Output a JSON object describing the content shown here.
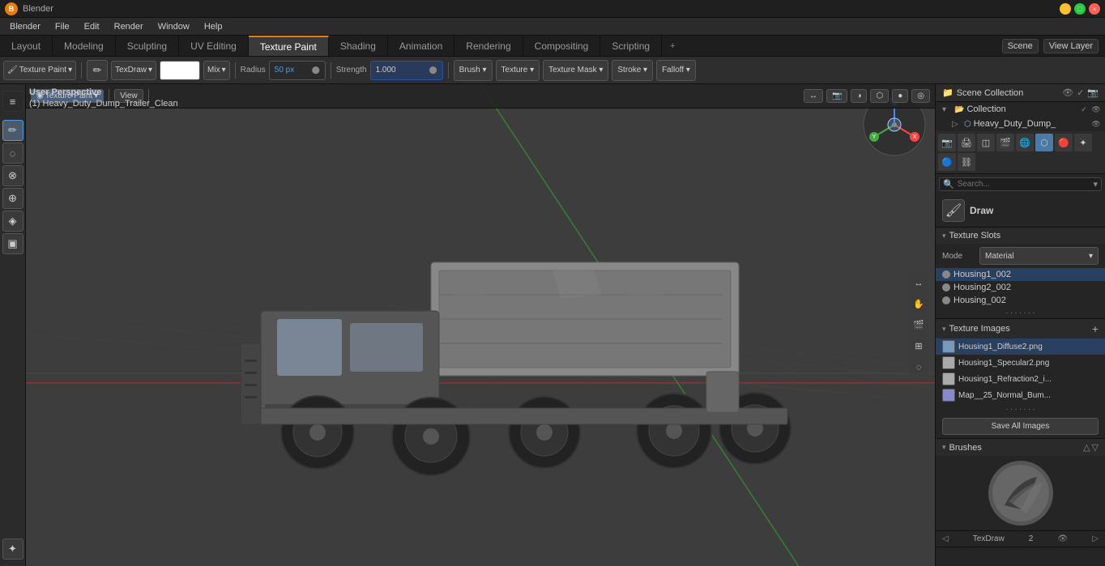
{
  "titlebar": {
    "title": "Blender",
    "logo": "B"
  },
  "menubar": {
    "items": [
      "Blender",
      "File",
      "Edit",
      "Render",
      "Window",
      "Help"
    ]
  },
  "workspacetabs": {
    "tabs": [
      "Layout",
      "Modeling",
      "Sculpting",
      "UV Editing",
      "Texture Paint",
      "Shading",
      "Animation",
      "Rendering",
      "Compositing",
      "Scripting"
    ],
    "active": "Texture Paint",
    "plus_label": "+",
    "scene_label": "Scene",
    "view_layer_label": "View Layer"
  },
  "toolbar_top": {
    "mode_label": "Texture Paint",
    "brush_label": "TexDraw",
    "blend_label": "Mix",
    "radius_label": "Radius",
    "radius_value": "50 px",
    "strength_label": "Strength",
    "strength_value": "1.000",
    "brush_btn": "Brush ▾",
    "texture_btn": "Texture ▾",
    "texture_mask_btn": "Texture Mask ▾",
    "stroke_btn": "Stroke ▾",
    "falloff_btn": "Falloff ▾"
  },
  "header_bar": {
    "panel_label": "Texture Paint",
    "view_btn": "View",
    "mode_icon": "◉"
  },
  "viewport": {
    "perspective": "User Perspective",
    "object": "(1) Heavy_Duty_Dump_Trailer_Clean"
  },
  "left_toolbar": {
    "tools": [
      {
        "name": "select",
        "icon": "◱",
        "active": false
      },
      {
        "name": "cursor",
        "icon": "✛",
        "active": false
      },
      {
        "name": "paint-brush",
        "icon": "✏",
        "active": true
      },
      {
        "name": "clone",
        "icon": "⊕",
        "active": false
      },
      {
        "name": "fill",
        "icon": "◈",
        "active": false
      },
      {
        "name": "smear",
        "icon": "⊗",
        "active": false
      },
      {
        "name": "mask",
        "icon": "▣",
        "active": false
      },
      {
        "name": "eyedropper",
        "icon": "✦",
        "active": false
      }
    ]
  },
  "right_panel": {
    "scene_collection_label": "Scene Collection",
    "collection_label": "Collection",
    "object_label": "Heavy_Duty_Dump_",
    "collection_icons": [
      "👁",
      "🖱",
      "📷"
    ],
    "props_toolbar_icons": [
      "≡",
      "📷",
      "🔧",
      "⬡",
      "🎨",
      "🌑",
      "📐",
      "🔗",
      "🔴",
      "⚙"
    ],
    "active_props_icon": 5,
    "draw_label": "Draw",
    "texture_slots_label": "Texture Slots",
    "texture_slots": [
      {
        "name": "Housing1_002",
        "active": true
      },
      {
        "name": "Housing2_002",
        "active": false
      },
      {
        "name": "Housing_002",
        "active": false
      }
    ],
    "mode_label": "Mode",
    "mode_value": "Material",
    "texture_images_label": "Texture Images",
    "texture_images": [
      {
        "name": "Housing1_Diffuse2.png",
        "color": "#8899aa",
        "active": true
      },
      {
        "name": "Housing1_Specular2.png",
        "color": "#aaaaaa",
        "active": false
      },
      {
        "name": "Housing1_Refraction2_i...",
        "color": "#aaaaaa",
        "active": false
      },
      {
        "name": "Map__25_Normal_Bum...",
        "color": "#8888cc",
        "active": false
      }
    ],
    "save_all_label": "Save All Images",
    "brushes_label": "Brushes",
    "brush_name": "TexDraw",
    "brush_number": "2"
  },
  "viewport_controls": {
    "buttons": [
      "↔",
      "✋",
      "🎬",
      "⊞",
      "◌"
    ]
  },
  "colors": {
    "accent": "#e87d0d",
    "active_blue": "#2a4060",
    "active_tab": "#3a3a3a",
    "bg_dark": "#1e1e1e",
    "bg_mid": "#2b2b2b",
    "bg_panel": "#252525"
  }
}
